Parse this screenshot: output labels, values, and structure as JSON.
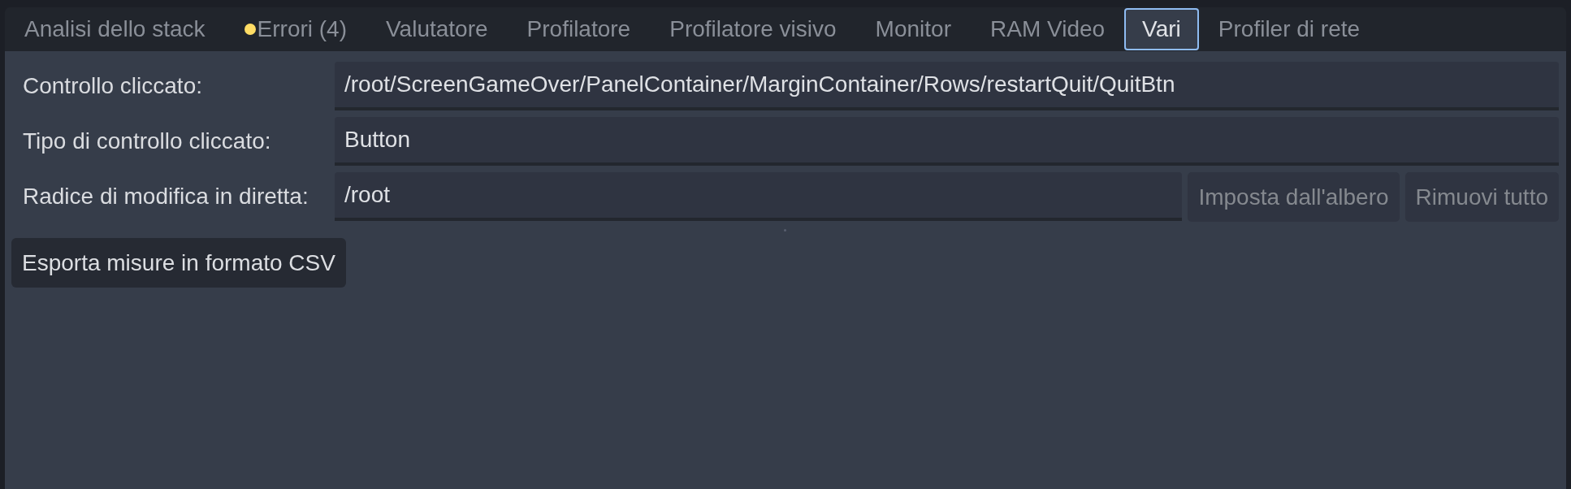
{
  "tabs": [
    {
      "label": "Analisi dello stack",
      "selected": false,
      "warning": false
    },
    {
      "label": "Errori (4)",
      "selected": false,
      "warning": true
    },
    {
      "label": "Valutatore",
      "selected": false,
      "warning": false
    },
    {
      "label": "Profilatore",
      "selected": false,
      "warning": false
    },
    {
      "label": "Profilatore visivo",
      "selected": false,
      "warning": false
    },
    {
      "label": "Monitor",
      "selected": false,
      "warning": false
    },
    {
      "label": "RAM Video",
      "selected": false,
      "warning": false
    },
    {
      "label": "Vari",
      "selected": true,
      "warning": false
    },
    {
      "label": "Profiler di rete",
      "selected": false,
      "warning": false
    }
  ],
  "rows": [
    {
      "label": "Controllo cliccato:",
      "value": "/root/ScreenGameOver/PanelContainer/MarginContainer/Rows/restartQuit/QuitBtn"
    },
    {
      "label": "Tipo di controllo cliccato:",
      "value": "Button"
    },
    {
      "label": "Radice di modifica in diretta:",
      "value": "/root",
      "buttons": [
        {
          "label": "Imposta dall'albero",
          "disabled": true
        },
        {
          "label": "Rimuovi tutto",
          "disabled": true
        }
      ]
    }
  ],
  "export_button": {
    "label": "Esporta misure in formato CSV",
    "disabled": false
  }
}
